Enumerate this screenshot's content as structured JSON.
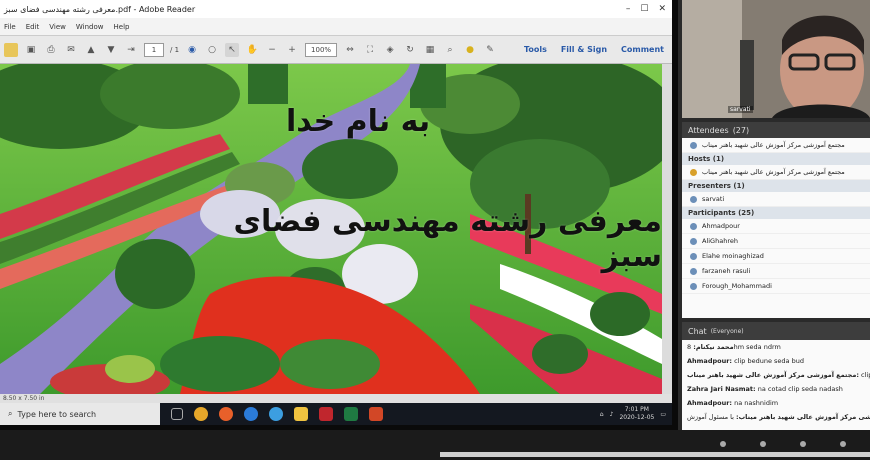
{
  "reader": {
    "title": "معرفی رشته مهندسی فضای سبز.pdf - Adobe Reader",
    "menu": [
      "File",
      "Edit",
      "View",
      "Window",
      "Help"
    ],
    "page_current": "1",
    "page_total": "/ 1",
    "zoom": "100%",
    "tools_link": "Tools",
    "fill_sign_link": "Fill & Sign",
    "comment_link": "Comment",
    "status_text": "8.50 x 7.50 in"
  },
  "slide": {
    "line1": "به نام خدا",
    "line2": "معرفی رشته مهندسی فضای سبز"
  },
  "taskbar": {
    "search_placeholder": "Type here to search",
    "time": "7:01 PM",
    "date": "2020-12-05"
  },
  "webcam": {
    "name": "sarvati"
  },
  "attendees": {
    "header": "Attendees",
    "count": "(27)",
    "top_item": "مجتمع آموزشی مرکز آموزش عالی شهید باهنر میناب",
    "hosts_label": "Hosts",
    "hosts_count": "(1)",
    "hosts": [
      "مجتمع آموزشی مرکز آموزش عالی شهید باهنر میناب"
    ],
    "presenters_label": "Presenters",
    "presenters_count": "(1)",
    "presenters": [
      "sarvati"
    ],
    "participants_label": "Participants",
    "participants_count": "(25)",
    "participants": [
      "Ahmadpour",
      "AliGhahreh",
      "Elahe moinaghizad",
      "farzaneh rasuli",
      "Forough_Mohammadi"
    ]
  },
  "chat": {
    "header": "Chat",
    "scope": "(Everyone)",
    "messages": [
      {
        "sender": "محمد نیکنام:",
        "text": "8hm seda ndrm"
      },
      {
        "sender": "Ahmadpour:",
        "text": "clip bedune seda bud"
      },
      {
        "sender": "مجتمع آموزشی مرکز آموزش عالی شهید باهنر میناب:",
        "text": "clip seda"
      },
      {
        "sender": "Zahra Jari Nasmat:",
        "text": "na cotad clip seda nadash"
      },
      {
        "sender": "Ahmadpour:",
        "text": "na nashnidim"
      },
      {
        "sender": "مجتمع آموزشی مرکز آموزش عالی شهید باهنر میناب:",
        "text": "با مسئول آموزش... typing"
      }
    ]
  },
  "colors": {
    "accent": "#2a5aa8",
    "taskbar": "#141820",
    "panel_header": "#3d3d3d"
  }
}
